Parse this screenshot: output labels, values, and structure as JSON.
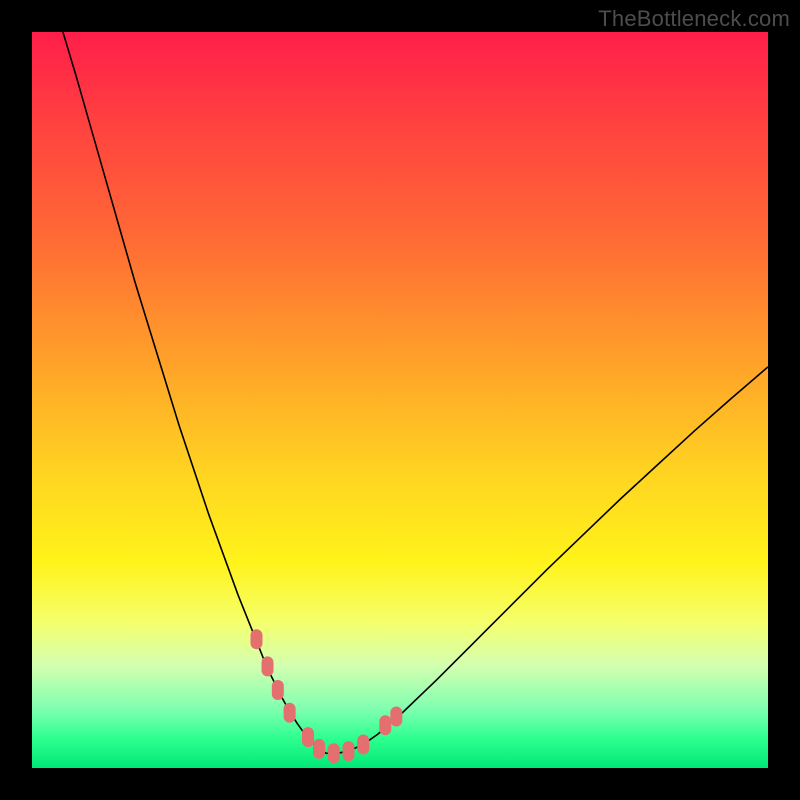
{
  "brand": {
    "label": "TheBottleneck.com"
  },
  "chart_data": {
    "type": "line",
    "title": "",
    "xlabel": "",
    "ylabel": "",
    "xlim": [
      0,
      100
    ],
    "ylim": [
      0,
      100
    ],
    "grid": false,
    "legend": false,
    "series": [
      {
        "name": "bottleneck-curve",
        "x": [
          4.2,
          6,
          8,
          10,
          12,
          14,
          16,
          18,
          20,
          22,
          24,
          26,
          28,
          30,
          32,
          34,
          35,
          36,
          37,
          38,
          39,
          40,
          41.5,
          43,
          45,
          47,
          50,
          55,
          60,
          65,
          70,
          75,
          80,
          85,
          90,
          95,
          100
        ],
        "y": [
          100,
          94,
          87,
          80,
          73,
          66,
          59.5,
          53,
          46.5,
          40.5,
          34.5,
          29,
          23.5,
          18.5,
          13.5,
          9.5,
          7.7,
          6.1,
          4.7,
          3.5,
          2.5,
          2.0,
          2.0,
          2.3,
          3.2,
          4.6,
          7.2,
          12.0,
          17.0,
          22.0,
          27.0,
          31.8,
          36.6,
          41.2,
          45.8,
          50.2,
          54.5
        ]
      }
    ],
    "markers": [
      {
        "name": "left-cluster-top",
        "x": 30.5,
        "y": 17.5
      },
      {
        "name": "left-cluster-upper",
        "x": 32.0,
        "y": 13.8
      },
      {
        "name": "left-cluster-mid",
        "x": 33.4,
        "y": 10.6
      },
      {
        "name": "left-cluster-lower",
        "x": 35.0,
        "y": 7.5
      },
      {
        "name": "bottom-left",
        "x": 37.5,
        "y": 4.2
      },
      {
        "name": "bottom-center-1",
        "x": 39.0,
        "y": 2.6
      },
      {
        "name": "bottom-center-2",
        "x": 41.0,
        "y": 2.0
      },
      {
        "name": "bottom-center-3",
        "x": 43.0,
        "y": 2.3
      },
      {
        "name": "bottom-right",
        "x": 45.0,
        "y": 3.2
      },
      {
        "name": "right-lower",
        "x": 48.0,
        "y": 5.8
      },
      {
        "name": "right-upper",
        "x": 49.5,
        "y": 7.0
      }
    ],
    "background_gradient": {
      "top": "#ff1e4a",
      "upper_mid": "#ffa229",
      "mid": "#fff31a",
      "lower_mid": "#d4ffb0",
      "bottom": "#00e878"
    }
  }
}
